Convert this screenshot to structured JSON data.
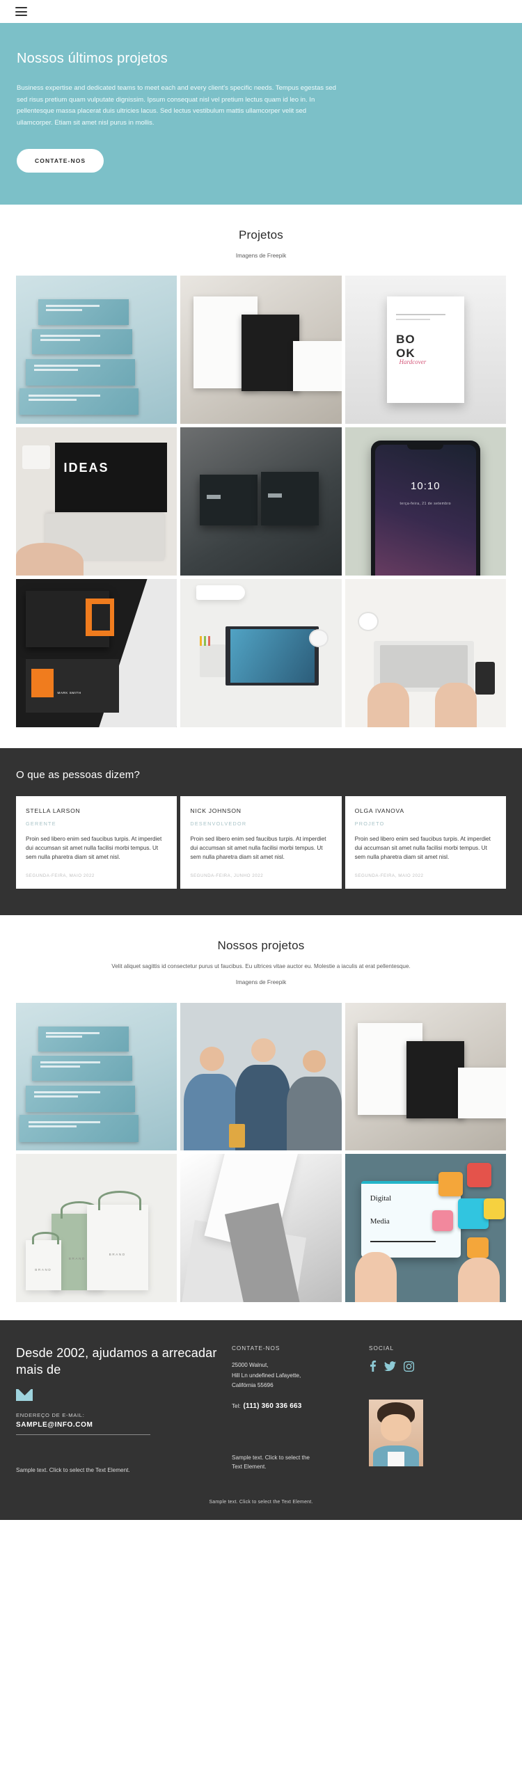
{
  "topbar": {
    "menu_icon": "hamburger-menu-icon"
  },
  "hero": {
    "title": "Nossos últimos projetos",
    "paragraph": "Business expertise and dedicated teams to meet each and every client's specific needs. Tempus egestas sed sed risus pretium quam vulputate dignissim. Ipsum consequat nisl vel pretium lectus quam id leo in. In pellentesque massa placerat duis ultricies lacus. Sed lectus vestibulum mattis ullamcorper velit sed ullamcorper. Etiam sit amet nisl purus in mollis.",
    "button_label": "CONTATE-NOS",
    "background_color": "#7cc0c8"
  },
  "projects_section": {
    "title": "Projetos",
    "credit": "Imagens de Freepik",
    "tiles": [
      {
        "name": "stacked-books-mockup"
      },
      {
        "name": "black-white-business-cards"
      },
      {
        "name": "book-cover-mockup"
      },
      {
        "name": "ideas-laptop-desk"
      },
      {
        "name": "dark-business-card-stack"
      },
      {
        "name": "smartphone-mockup"
      },
      {
        "name": "orange-black-business-cards"
      },
      {
        "name": "desk-stationery-mockup"
      },
      {
        "name": "typing-on-laptop"
      }
    ]
  },
  "testimonials_section": {
    "title": "O que as pessoas dizem?",
    "background_color": "#333333",
    "items": [
      {
        "name": "STELLA LARSON",
        "role": "GERENTE",
        "quote": "Proin sed libero enim sed faucibus turpis. At imperdiet dui accumsan sit amet nulla facilisi morbi tempus. Ut sem nulla pharetra diam sit amet nisl.",
        "date": "SEGUNDA-FEIRA, MAIO 2022"
      },
      {
        "name": "NICK JOHNSON",
        "role": "DESENVOLVEDOR",
        "quote": "Proin sed libero enim sed faucibus turpis. At imperdiet dui accumsan sit amet nulla facilisi morbi tempus. Ut sem nulla pharetra diam sit amet nisl.",
        "date": "SEGUNDA-FEIRA, JUNHO 2022"
      },
      {
        "name": "OLGA IVANOVA",
        "role": "PROJETO",
        "quote": "Proin sed libero enim sed faucibus turpis. At imperdiet dui accumsan sit amet nulla facilisi morbi tempus. Ut sem nulla pharetra diam sit amet nisl.",
        "date": "SEGUNDA-FEIRA, MAIO 2022"
      }
    ]
  },
  "projects_section_2": {
    "title": "Nossos projetos",
    "subtitle": "Velit aliquet sagittis id consectetur purus ut faucibus. Eu ultrices vitae auctor eu. Molestie a iaculis at erat pellentesque.",
    "credit": "Imagens de Freepik",
    "tiles": [
      {
        "name": "stacked-books-mockup"
      },
      {
        "name": "team-meeting-photo"
      },
      {
        "name": "black-white-business-cards"
      },
      {
        "name": "shopping-bags-mockup"
      },
      {
        "name": "folded-paper-abstract"
      },
      {
        "name": "digital-media-tablet"
      }
    ]
  },
  "footer": {
    "heading": "Desde 2002, ajudamos a arrecadar mais de",
    "mail_icon": "envelope-icon",
    "email_label": "ENDEREÇO DE E-MAIL:",
    "email_value": "SAMPLE@INFO.COM",
    "sample_left": "Sample text. Click to select the Text Element.",
    "contact": {
      "title": "CONTATE-NOS",
      "address_line1": "25000 Walnut,",
      "address_line2": "Hill Ln undefined Lafayette,",
      "address_line3": "Califórnia 55696",
      "tel_label": "Tel:",
      "tel_value": "(111) 360 336 663",
      "sample_text": "Sample text. Click to select the Text Element."
    },
    "social": {
      "title": "SOCIAL",
      "icons": [
        "facebook-icon",
        "twitter-icon",
        "instagram-icon"
      ],
      "color": "#8ecbd6",
      "avatar": "person-portrait-avatar"
    },
    "bottom_text": "Sample text. Click to select the Text Element.",
    "background_color": "#333333"
  }
}
